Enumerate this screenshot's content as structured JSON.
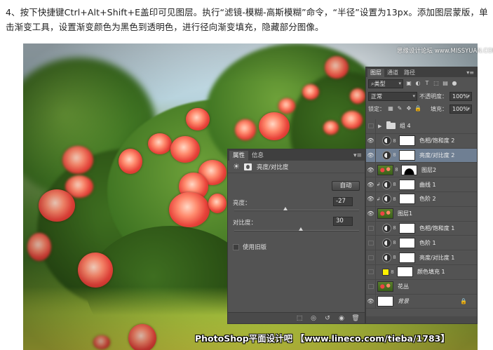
{
  "instruction": "4、按下快捷键Ctrl+Alt+Shift+E盖印可见图层。执行“滤镜-模糊-高斯模糊”命令，“半径”设置为13px。添加图层蒙版，单击渐变工具，设置渐变颜色为黑色到透明色，进行径向渐变填充，隐藏部分图像。",
  "watermark_top": "思缘设计论坛 www.MISSYUAN.COM",
  "watermark_bottom": "PhotoShop平面设计吧 【www.lineco.com/tieba/1783】",
  "properties_panel": {
    "tabs": [
      "属性",
      "信息"
    ],
    "menu_icon": "panel-menu-icon",
    "title": "亮度/对比度",
    "auto_label": "自动",
    "brightness_label": "亮度：",
    "brightness_value": "-27",
    "brightness_level": -27,
    "contrast_label": "对比度：",
    "contrast_value": "30",
    "contrast_level": 30,
    "legacy_label": "使用旧版",
    "footer_icons": [
      "clip-to-layer-icon",
      "view-previous-icon",
      "reset-icon",
      "visibility-icon",
      "delete-icon"
    ]
  },
  "layers_panel": {
    "tabs": [
      "图层",
      "通道",
      "路径"
    ],
    "filter_kind": "类型",
    "blend_mode": "正常",
    "opacity_label": "不透明度：",
    "opacity_value": "100%",
    "lock_label": "锁定：",
    "fill_label": "填充：",
    "fill_value": "100%",
    "layers": [
      {
        "name": "组 4",
        "kind": "group",
        "visible": false
      },
      {
        "name": "色相/饱和度 2",
        "kind": "adjustment",
        "visible": true
      },
      {
        "name": "亮度/对比度 2",
        "kind": "adjustment",
        "visible": true,
        "selected": true
      },
      {
        "name": "图层2",
        "kind": "pixel-mask",
        "visible": true
      },
      {
        "name": "曲线 1",
        "kind": "adjustment",
        "visible": true,
        "clipped": true
      },
      {
        "name": "色阶 2",
        "kind": "adjustment",
        "visible": true,
        "clipped": true
      },
      {
        "name": "图层1",
        "kind": "pixel",
        "visible": true
      },
      {
        "name": "色相/饱和度 1",
        "kind": "adjustment",
        "visible": false
      },
      {
        "name": "色阶 1",
        "kind": "adjustment",
        "visible": false
      },
      {
        "name": "亮度/对比度 1",
        "kind": "adjustment",
        "visible": false
      },
      {
        "name": "颜色填充 1",
        "kind": "fill",
        "visible": false,
        "fill_color": "#fff200"
      },
      {
        "name": "花丛",
        "kind": "pixel",
        "visible": false
      },
      {
        "name": "背景",
        "kind": "background",
        "visible": true,
        "locked": true
      }
    ]
  }
}
